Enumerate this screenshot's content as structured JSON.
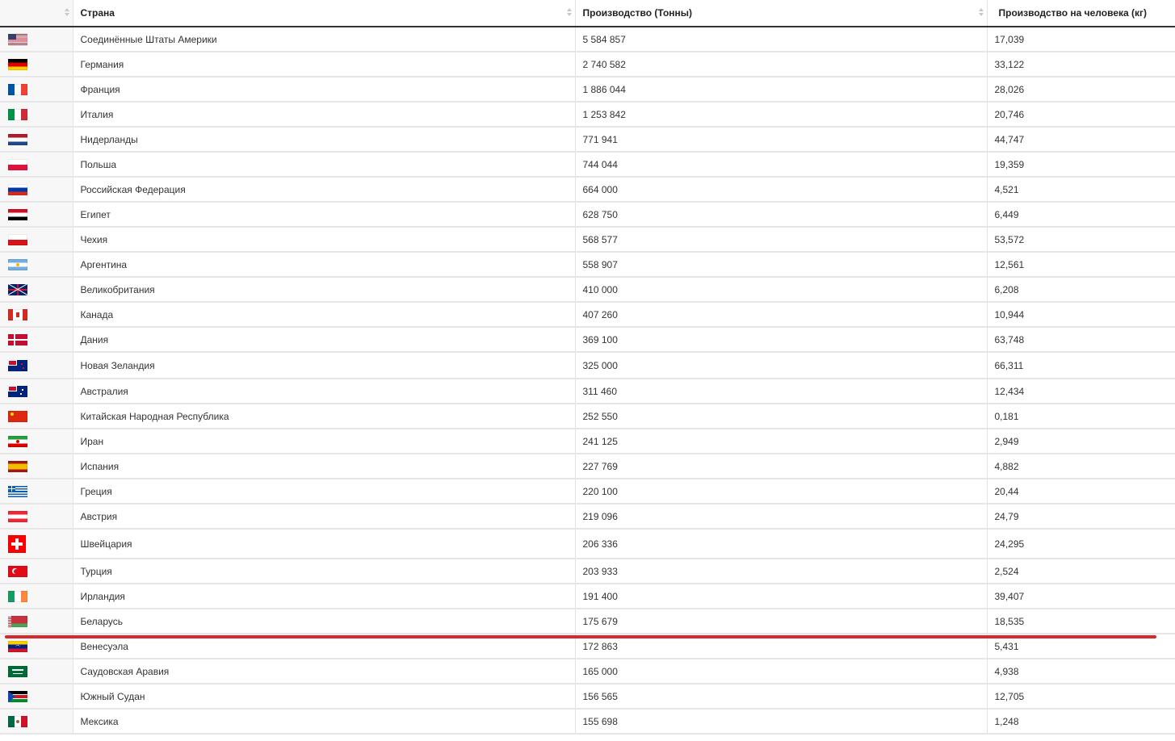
{
  "chart_data": {
    "type": "table",
    "columns": [
      "",
      "Страна",
      "Производство (Тонны)",
      "Производство на человека (кг)"
    ],
    "rows": [
      {
        "flag": "us-flag-icon",
        "country": "Соединённые Штаты Америки",
        "production": "5 584 857",
        "per_capita": "17,039"
      },
      {
        "flag": "germany-flag-icon",
        "country": "Германия",
        "production": "2 740 582",
        "per_capita": "33,122"
      },
      {
        "flag": "france-flag-icon",
        "country": "Франция",
        "production": "1 886 044",
        "per_capita": "28,026"
      },
      {
        "flag": "italy-flag-icon",
        "country": "Италия",
        "production": "1 253 842",
        "per_capita": "20,746"
      },
      {
        "flag": "netherlands-flag-icon",
        "country": "Нидерланды",
        "production": "771 941",
        "per_capita": "44,747"
      },
      {
        "flag": "poland-flag-icon",
        "country": "Польша",
        "production": "744 044",
        "per_capita": "19,359"
      },
      {
        "flag": "russia-flag-icon",
        "country": "Российская Федерация",
        "production": "664 000",
        "per_capita": "4,521"
      },
      {
        "flag": "egypt-flag-icon",
        "country": "Египет",
        "production": "628 750",
        "per_capita": "6,449"
      },
      {
        "flag": "czechia-flag-icon",
        "country": "Чехия",
        "production": "568 577",
        "per_capita": "53,572"
      },
      {
        "flag": "argentina-flag-icon",
        "country": "Аргентина",
        "production": "558 907",
        "per_capita": "12,561"
      },
      {
        "flag": "uk-flag-icon",
        "country": "Великобритания",
        "production": "410 000",
        "per_capita": "6,208"
      },
      {
        "flag": "canada-flag-icon",
        "country": "Канада",
        "production": "407 260",
        "per_capita": "10,944"
      },
      {
        "flag": "denmark-flag-icon",
        "country": "Дания",
        "production": "369 100",
        "per_capita": "63,748"
      },
      {
        "flag": "new-zealand-flag-icon",
        "country": "Новая Зеландия",
        "production": "325 000",
        "per_capita": "66,311"
      },
      {
        "flag": "australia-flag-icon",
        "country": "Австралия",
        "production": "311 460",
        "per_capita": "12,434"
      },
      {
        "flag": "china-flag-icon",
        "country": "Китайская Народная Республика",
        "production": "252 550",
        "per_capita": "0,181"
      },
      {
        "flag": "iran-flag-icon",
        "country": "Иран",
        "production": "241 125",
        "per_capita": "2,949"
      },
      {
        "flag": "spain-flag-icon",
        "country": "Испания",
        "production": "227 769",
        "per_capita": "4,882"
      },
      {
        "flag": "greece-flag-icon",
        "country": "Греция",
        "production": "220 100",
        "per_capita": "20,44"
      },
      {
        "flag": "austria-flag-icon",
        "country": "Австрия",
        "production": "219 096",
        "per_capita": "24,79"
      },
      {
        "flag": "switzerland-flag-icon",
        "country": "Швейцария",
        "production": "206 336",
        "per_capita": "24,295"
      },
      {
        "flag": "turkey-flag-icon",
        "country": "Турция",
        "production": "203 933",
        "per_capita": "2,524"
      },
      {
        "flag": "ireland-flag-icon",
        "country": "Ирландия",
        "production": "191 400",
        "per_capita": "39,407"
      },
      {
        "flag": "belarus-flag-icon",
        "country": "Беларусь",
        "production": "175 679",
        "per_capita": "18,535"
      },
      {
        "flag": "venezuela-flag-icon",
        "country": "Венесуэла",
        "production": "172 863",
        "per_capita": "5,431"
      },
      {
        "flag": "saudi-arabia-flag-icon",
        "country": "Саудовская Аравия",
        "production": "165 000",
        "per_capita": "4,938"
      },
      {
        "flag": "south-sudan-flag-icon",
        "country": "Южный Судан",
        "production": "156 565",
        "per_capita": "12,705"
      },
      {
        "flag": "mexico-flag-icon",
        "country": "Мексика",
        "production": "155 698",
        "per_capita": "1,248"
      }
    ]
  },
  "colors": {
    "highlight_line": "#d42a30",
    "header_border": "#333333",
    "row_border": "#e6e6e6",
    "flag_column_bg": "#f7f7f7"
  }
}
